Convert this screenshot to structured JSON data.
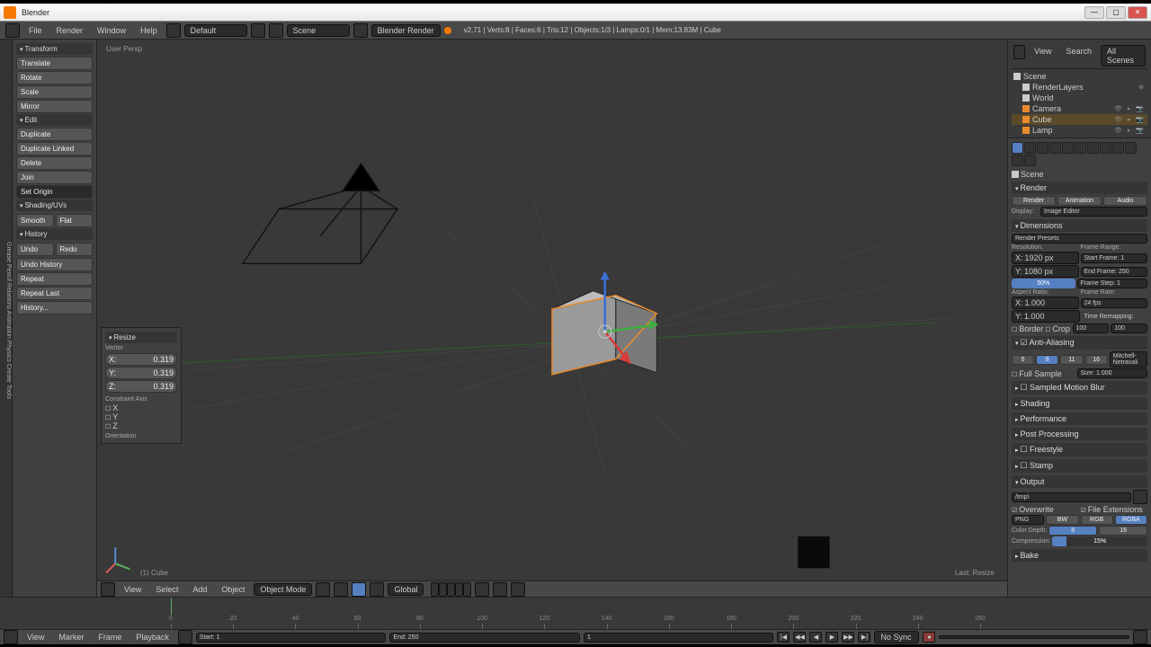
{
  "window": {
    "title": "Blender"
  },
  "topbar": {
    "menus": [
      "File",
      "Render",
      "Window",
      "Help"
    ],
    "layout": "Default",
    "scene": "Scene",
    "engine": "Blender Render",
    "stats": "v2.71 | Verts:8 | Faces:6 | Tris:12 | Objects:1/3 | Lamps:0/1 | Mem:13.83M | Cube"
  },
  "toolshelf": {
    "tabs": "Grease Pencil  Relations  Animation  Physics  Create  Tools",
    "transform": {
      "head": "Transform",
      "translate": "Translate",
      "rotate": "Rotate",
      "scale": "Scale",
      "mirror": "Mirror"
    },
    "edit": {
      "head": "Edit",
      "duplicate": "Duplicate",
      "duplicate_linked": "Duplicate Linked",
      "delete": "Delete",
      "join": "Join",
      "set_origin": "Set Origin"
    },
    "shading": {
      "head": "Shading/UVs",
      "smooth": "Smooth",
      "flat": "Flat"
    },
    "history": {
      "head": "History",
      "undo": "Undo",
      "redo": "Redo",
      "undo_history": "Undo History",
      "repeat": "Repeat",
      "repeat_last": "Repeat Last",
      "history_btn": "History..."
    }
  },
  "viewport": {
    "persp": "User Persp",
    "object": "(1) Cube",
    "last_op": "Last: Resize",
    "footer": {
      "view": "View",
      "select": "Select",
      "add": "Add",
      "object": "Object",
      "mode": "Object Mode",
      "orient": "Global"
    }
  },
  "resize_panel": {
    "head": "Resize",
    "vector": "Vector",
    "x": "X:",
    "y": "Y:",
    "z": "Z:",
    "xval": "0.319",
    "yval": "0.319",
    "zval": "0.319",
    "constraint": "Constraint Axis",
    "cx": "X",
    "cy": "Y",
    "cz": "Z",
    "orientation": "Orientation"
  },
  "outliner": {
    "view": "View",
    "search": "Search",
    "all": "All Scenes",
    "scene": "Scene",
    "render_layers": "RenderLayers",
    "world": "World",
    "camera": "Camera",
    "cube": "Cube",
    "lamp": "Lamp"
  },
  "props": {
    "breadcrumb": "Scene",
    "render": {
      "head": "Render",
      "render_btn": "Render",
      "animation": "Animation",
      "audio": "Audio",
      "display": "Display:",
      "display_val": "Image Editor"
    },
    "dimensions": {
      "head": "Dimensions",
      "presets": "Render Presets",
      "resolution": "Resolution:",
      "frame_range": "Frame Range:",
      "x": "X:",
      "xval": "1920 px",
      "y": "Y:",
      "yval": "1080 px",
      "pct": "50%",
      "start": "Start Frame: 1",
      "end": "End Frame: 250",
      "step": "Frame Step: 1",
      "aspect": "Aspect Ratio:",
      "ax": "1.000",
      "ay": "1.000",
      "frame_rate": "Frame Rate:",
      "fps": "24 fps",
      "time_remap": "Time Remapping:",
      "old": "100",
      "new": "100",
      "border": "Border",
      "crop": "Crop"
    },
    "aa": {
      "head": "Anti-Aliasing",
      "s5": "5",
      "s8": "8",
      "s11": "11",
      "s16": "16",
      "filter": "Mitchell-Netravali",
      "full": "Full Sample",
      "size": "Size: 1.000"
    },
    "blur": {
      "head": "Sampled Motion Blur"
    },
    "shading": {
      "head": "Shading"
    },
    "perf": {
      "head": "Performance"
    },
    "post": {
      "head": "Post Processing"
    },
    "freestyle": {
      "head": "Freestyle"
    },
    "stamp": {
      "head": "Stamp"
    },
    "output": {
      "head": "Output",
      "path": "/tmp\\",
      "overwrite": "Overwrite",
      "ext": "File Extensions",
      "format": "PNG",
      "bw": "BW",
      "rgb": "RGB",
      "rgba": "RGBA",
      "depth": "Color Depth:",
      "d8": "8",
      "d16": "16",
      "compression": "Compression:",
      "comp_val": "15%"
    },
    "bake": {
      "head": "Bake"
    }
  },
  "timeline": {
    "view": "View",
    "marker": "Marker",
    "frame": "Frame",
    "playback": "Playback",
    "start": "Start: 1",
    "end": "End: 250",
    "current": "1",
    "sync": "No Sync",
    "ticks": [
      0,
      20,
      40,
      60,
      80,
      100,
      120,
      140,
      160,
      180,
      200,
      220,
      240,
      260
    ]
  }
}
